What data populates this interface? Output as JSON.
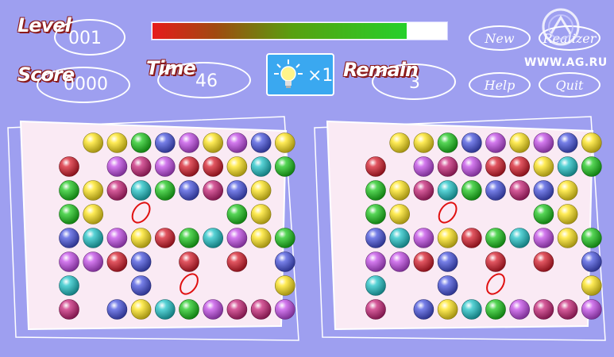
{
  "hud": {
    "level_label": "Level",
    "level_value": "001",
    "score_label": "Score",
    "score_value": "0000",
    "time_label": "Time",
    "time_value": "46",
    "remain_label": "Remain",
    "remain_value": "3",
    "time_progress": 0.92,
    "hint_count": "×1"
  },
  "menu": {
    "new_label": "New",
    "realizer_label": "Realizer",
    "help_label": "Help",
    "quit_label": "Quit"
  },
  "watermark": "WWW.AG.RU",
  "colors": {
    "background": "#9e9ff0",
    "board_fill": "#faeaf4",
    "marker": "#e01010"
  },
  "ball_colors": {
    "Y": "#ffe51f",
    "G": "#1fc81f",
    "B": "#4a55e0",
    "P": "#c44de8",
    "R": "#d81f2e",
    "M": "#c8267a",
    "C": "#22c4c8"
  },
  "board": {
    "rows": [
      ".YYGBPYPBY",
      "R.PMPRRYCG",
      "GYMCGBMBY.",
      "GY.....GY.",
      "BCPYRGCPYG",
      "PPRB.R.R.B",
      "C..B.....Y",
      "M.BYCGPMMP"
    ],
    "differences": [
      {
        "row": 3,
        "col": 3
      },
      {
        "row": 6,
        "col": 5
      }
    ]
  }
}
